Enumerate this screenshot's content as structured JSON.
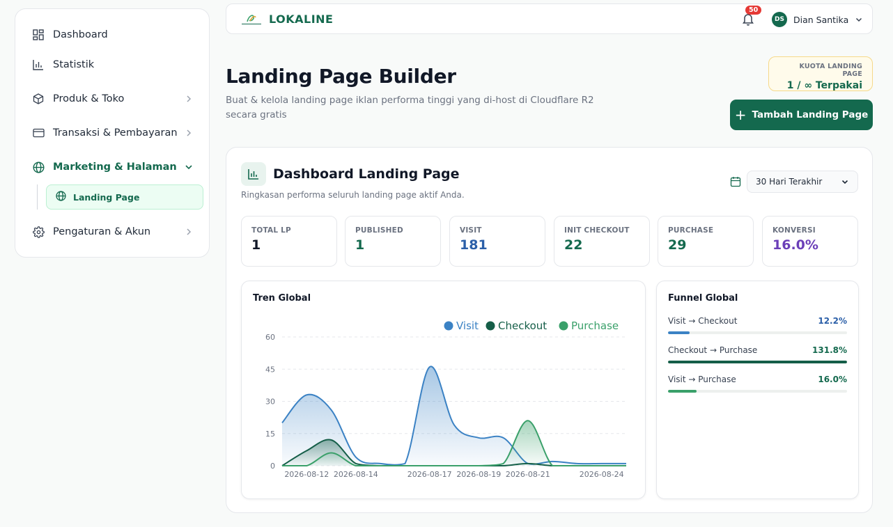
{
  "sidebar": {
    "items": [
      {
        "label": "Dashboard",
        "icon": "dashboard-icon"
      },
      {
        "label": "Statistik",
        "icon": "bar-chart-icon"
      },
      {
        "label": "Produk & Toko",
        "icon": "box-icon"
      },
      {
        "label": "Transaksi & Pembayaran",
        "icon": "credit-card-icon"
      },
      {
        "label": "Marketing & Halaman",
        "icon": "globe-icon"
      },
      {
        "label": "Pengaturan & Akun",
        "icon": "gear-icon"
      }
    ],
    "sub_item": {
      "label": "Landing Page",
      "icon": "globe-icon"
    }
  },
  "topbar": {
    "brand": "LOKALINE",
    "notification_count": "50",
    "user_initials": "DS",
    "user_name": "Dian Santika"
  },
  "header": {
    "title": "Landing Page Builder",
    "subtitle": "Buat & kelola landing page iklan performa tinggi yang di-host di Cloudflare R2 secara gratis",
    "quota_label": "KUOTA LANDING PAGE",
    "quota_value": "1 / ∞ Terpakai",
    "add_button": "Tambah Landing Page"
  },
  "dashboard": {
    "title": "Dashboard Landing Page",
    "subtitle": "Ringkasan performa seluruh landing page aktif Anda.",
    "range": "30 Hari Terakhir",
    "stats": [
      {
        "label": "TOTAL LP",
        "value": "1",
        "color": "#111827"
      },
      {
        "label": "PUBLISHED",
        "value": "1",
        "color": "#14694e"
      },
      {
        "label": "VISIT",
        "value": "181",
        "color": "#2b5fa8"
      },
      {
        "label": "INIT CHECKOUT",
        "value": "22",
        "color": "#14694e"
      },
      {
        "label": "PURCHASE",
        "value": "29",
        "color": "#14694e"
      },
      {
        "label": "KONVERSI",
        "value": "16.0%",
        "color": "#6b3fb8"
      }
    ]
  },
  "trend": {
    "title": "Tren Global"
  },
  "chart_data": {
    "type": "area",
    "x": [
      "2026-08-11",
      "2026-08-12",
      "2026-08-13",
      "2026-08-14",
      "2026-08-15",
      "2026-08-16",
      "2026-08-17",
      "2026-08-18",
      "2026-08-19",
      "2026-08-20",
      "2026-08-21",
      "2026-08-22",
      "2026-08-23",
      "2026-08-24",
      "2026-08-25"
    ],
    "x_tick_labels": [
      "2026-08-12",
      "2026-08-14",
      "2026-08-17",
      "2026-08-19",
      "2026-08-21",
      "2026-08-24"
    ],
    "series": [
      {
        "name": "Visit",
        "color": "#3b82c4",
        "values": [
          20,
          33,
          26,
          4,
          1,
          1,
          46,
          19,
          13,
          13,
          1,
          2,
          1,
          1,
          1
        ]
      },
      {
        "name": "Checkout",
        "color": "#155e48",
        "values": [
          0,
          7,
          12,
          1,
          0,
          0,
          0,
          0,
          0,
          0,
          1,
          0,
          0,
          0,
          0
        ]
      },
      {
        "name": "Purchase",
        "color": "#3aa06a",
        "values": [
          0,
          0,
          6,
          0,
          0,
          0,
          0,
          0,
          0,
          1,
          21,
          0,
          0,
          0,
          0
        ]
      }
    ],
    "ylim": [
      0,
      60
    ],
    "yticks": [
      0,
      15,
      30,
      45,
      60
    ],
    "grid": true,
    "legend": "top-right"
  },
  "funnel": {
    "title": "Funnel Global",
    "rows": [
      {
        "label": "Visit → Checkout",
        "value": "12.2%",
        "fill": 0.122,
        "color": "#3b82c4"
      },
      {
        "label": "Checkout → Purchase",
        "value": "131.8%",
        "fill": 1.0,
        "color": "#155e48"
      },
      {
        "label": "Visit → Purchase",
        "value": "16.0%",
        "fill": 0.16,
        "color": "#3aa06a"
      }
    ]
  }
}
